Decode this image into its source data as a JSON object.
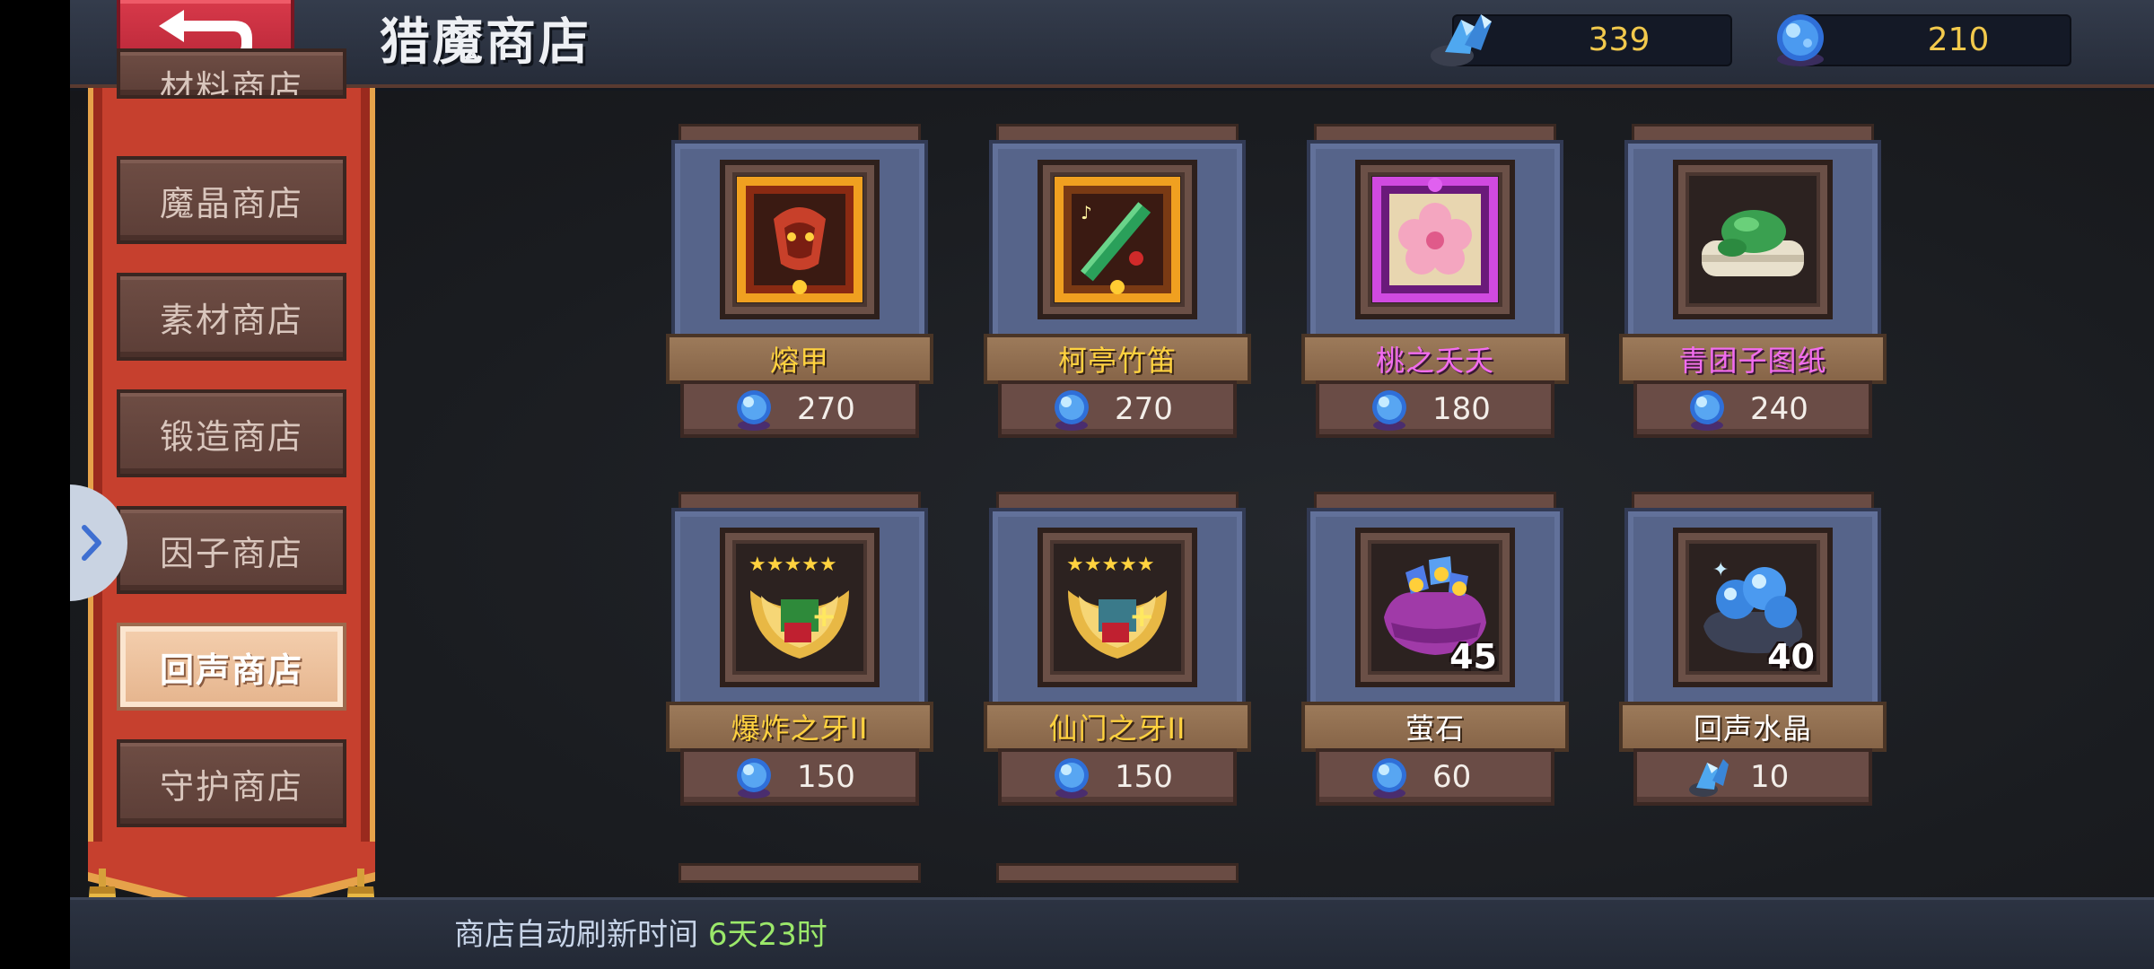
{
  "header": {
    "title": "猎魔商店",
    "currencies": [
      {
        "icon": "blue-crystal-icon",
        "value": "339"
      },
      {
        "icon": "blue-orb-icon",
        "value": "210"
      }
    ]
  },
  "menu": {
    "items": [
      {
        "label": "材料商店",
        "active": false
      },
      {
        "label": "魔晶商店",
        "active": false
      },
      {
        "label": "素材商店",
        "active": false
      },
      {
        "label": "锻造商店",
        "active": false
      },
      {
        "label": "因子商店",
        "active": false
      },
      {
        "label": "回声商店",
        "active": true
      },
      {
        "label": "守护商店",
        "active": false
      }
    ]
  },
  "shop": {
    "items": [
      {
        "name": "熔甲",
        "price": "270",
        "currency_icon": "blue-orb-icon",
        "icon": "molten-armor-icon",
        "name_color": "#ffd23f"
      },
      {
        "name": "柯亭竹笛",
        "price": "270",
        "currency_icon": "blue-orb-icon",
        "icon": "bamboo-flute-icon",
        "name_color": "#ffd23f"
      },
      {
        "name": "桃之夭夭",
        "price": "180",
        "currency_icon": "blue-orb-icon",
        "icon": "peach-blossom-icon",
        "name_color": "#f26cf0"
      },
      {
        "name": "青团子图纸",
        "price": "240",
        "currency_icon": "blue-orb-icon",
        "icon": "green-dumpling-scroll-icon",
        "name_color": "#f26cf0"
      },
      {
        "name": "爆炸之牙II",
        "price": "150",
        "currency_icon": "blue-orb-icon",
        "icon": "explosion-fang-badge-icon",
        "name_color": "#ffd23f"
      },
      {
        "name": "仙门之牙II",
        "price": "150",
        "currency_icon": "blue-orb-icon",
        "icon": "immortal-gate-fang-badge-icon",
        "name_color": "#ffd23f"
      },
      {
        "name": "萤石",
        "price": "60",
        "currency_icon": "blue-orb-icon",
        "icon": "fluorite-pouch-icon",
        "quantity": "45",
        "name_color": "#ffffff"
      },
      {
        "name": "回声水晶",
        "price": "10",
        "currency_icon": "blue-crystal-icon",
        "icon": "echo-crystal-icon",
        "quantity": "40",
        "name_color": "#ffffff"
      }
    ]
  },
  "footer": {
    "refresh_label": "商店自动刷新时间",
    "refresh_time": "6天23时"
  }
}
